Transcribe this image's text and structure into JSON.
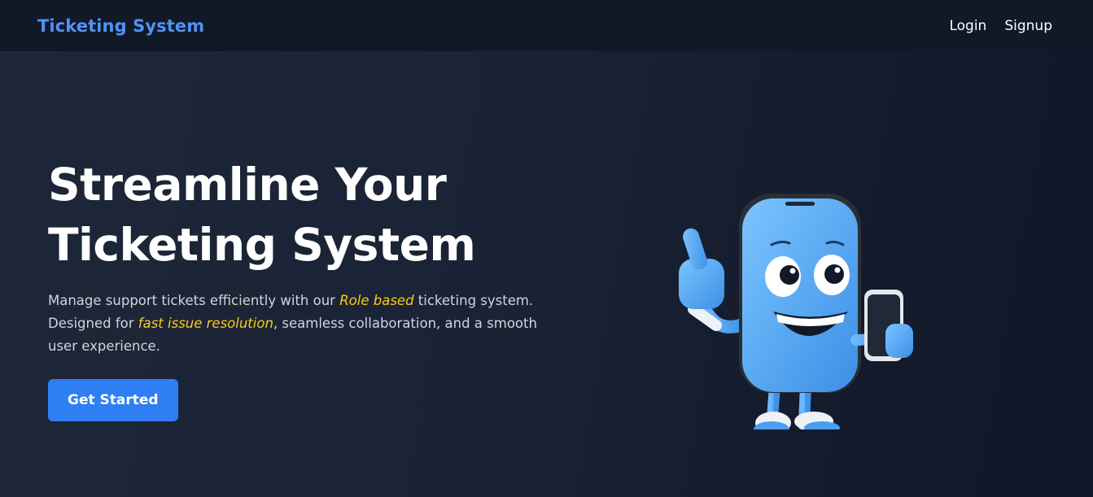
{
  "navbar": {
    "brand": "Ticketing System",
    "links": [
      {
        "label": "Login"
      },
      {
        "label": "Signup"
      }
    ]
  },
  "hero": {
    "title_line1": "Streamline Your",
    "title_line2": "Ticketing System",
    "desc_part1": "Manage support tickets efficiently with our ",
    "desc_highlight1": "Role based",
    "desc_part2": " ticketing system. Designed for ",
    "desc_highlight2": "fast issue resolution",
    "desc_part3": ", seamless collaboration, and a smooth user experience.",
    "cta_label": "Get Started",
    "illustration_icon": "smartphone-mascot-thumbs-up"
  },
  "colors": {
    "brand": "#4f93f5",
    "highlight": "#facc15",
    "cta": "#2f7ef3",
    "navbar_bg": "#111827"
  }
}
